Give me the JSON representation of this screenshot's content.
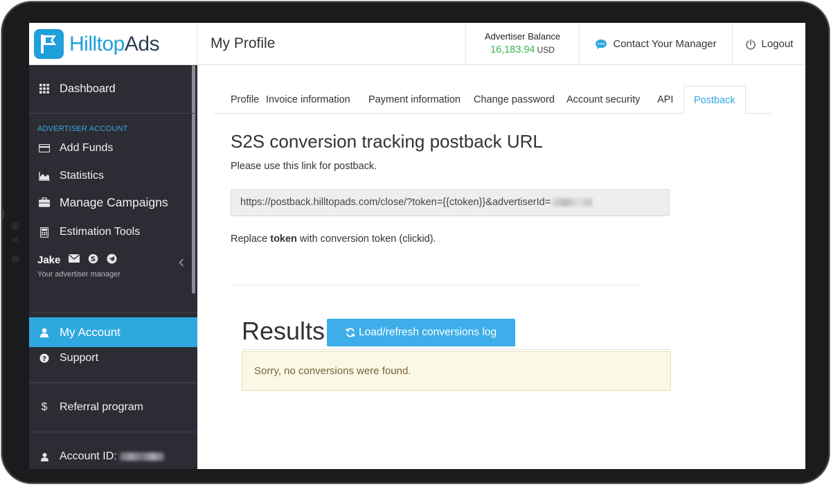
{
  "brand": {
    "part1": "Hilltop",
    "part2": "Ads"
  },
  "header": {
    "page_title": "My Profile",
    "balance_label": "Advertiser Balance",
    "balance_amount": "16,183.94",
    "balance_currency": "USD",
    "contact_label": "Contact Your Manager",
    "logout_label": "Logout"
  },
  "sidebar": {
    "dashboard": "Dashboard",
    "section_label": "ADVERTISER ACCOUNT",
    "add_funds": "Add Funds",
    "statistics": "Statistics",
    "manage_campaigns": "Manage Campaigns",
    "estimation_tools": "Estimation Tools",
    "manager_name": "Jake",
    "manager_sub": "Your advertiser manager",
    "my_account": "My Account",
    "support": "Support",
    "referral": "Referral program",
    "account_id_label": "Account ID:"
  },
  "tabs": [
    "Profile",
    "Invoice information",
    "Payment information",
    "Change password",
    "Account security",
    "API",
    "Postback"
  ],
  "postback": {
    "title": "S2S conversion tracking postback URL",
    "subtitle": "Please use this link for postback.",
    "url": "https://postback.hilltopads.com/close/?token={{ctoken}}&advertiserId=",
    "replace_prefix": "Replace ",
    "replace_bold": "token",
    "replace_suffix": " with conversion token (clickid)."
  },
  "results": {
    "title": "Results",
    "button_label": "Load/refresh conversions log",
    "empty_message": "Sorry, no conversions were found."
  },
  "colors": {
    "accent": "#2fa8e0",
    "sidebar_bg": "#2c2c35",
    "balance_green": "#3cb44a",
    "alert_bg": "#fbf8e6"
  }
}
